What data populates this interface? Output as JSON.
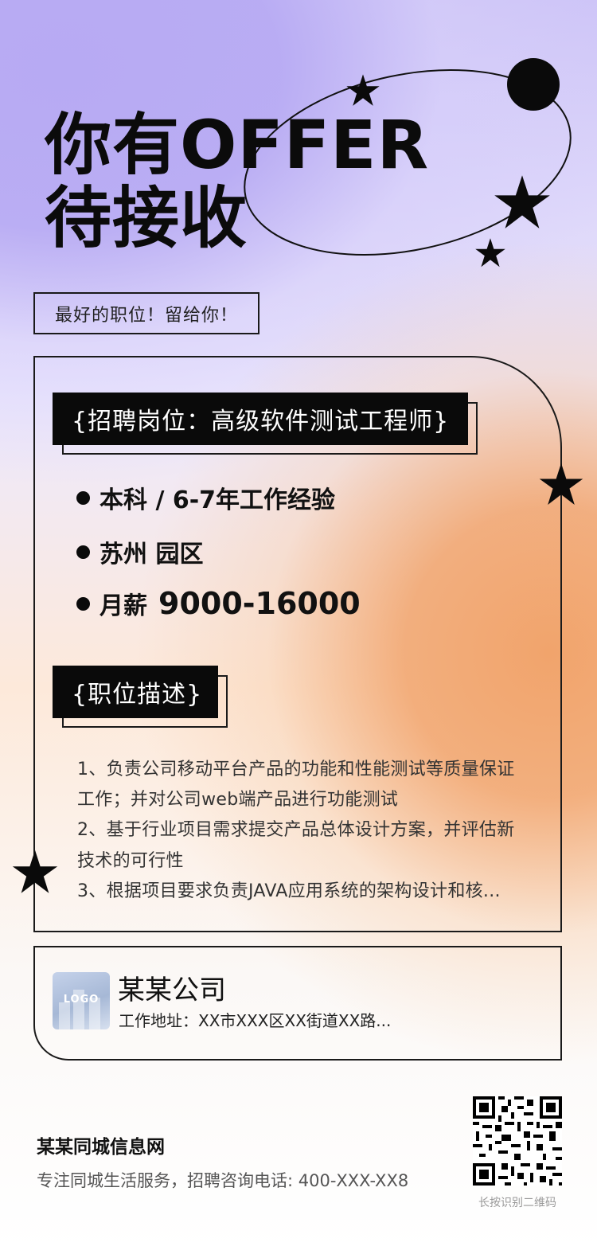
{
  "colors": {
    "accent_purple": "#b7aaf3",
    "accent_orange": "#f1a46c",
    "ink": "#0a0a0a"
  },
  "header": {
    "line1": "你有OFFER",
    "line2": "待接收",
    "slogan": "最好的职位！留给你！"
  },
  "job": {
    "position_tag": "{招聘岗位：高级软件测试工程师}",
    "requirements": [
      "本科 / 6-7年工作经验",
      "苏州 园区"
    ],
    "salary_label": "月薪",
    "salary_value": "9000-16000"
  },
  "description": {
    "tag": "{职位描述}",
    "lines": [
      "1、负责公司移动平台产品的功能和性能测试等质量保证",
      "工作；并对公司web端产品进行功能测试",
      "2、基于行业项目需求提交产品总体设计方案，并评估新",
      "技术的可行性",
      "3、根据项目要求负责JAVA应用系统的架构设计和核..."
    ]
  },
  "company": {
    "logo_text": "LOGO",
    "name": "某某公司",
    "address": "工作地址：XX市XXX区XX街道XX路..."
  },
  "footer": {
    "site_name": "某某同城信息网",
    "site_desc": "专注同城生活服务，招聘咨询电话: 400-XXX-XX8",
    "qr_caption": "长按识别二维码"
  },
  "icons": [
    "star-icon",
    "circle-dot",
    "orbit-ellipse",
    "qr-code-icon"
  ]
}
